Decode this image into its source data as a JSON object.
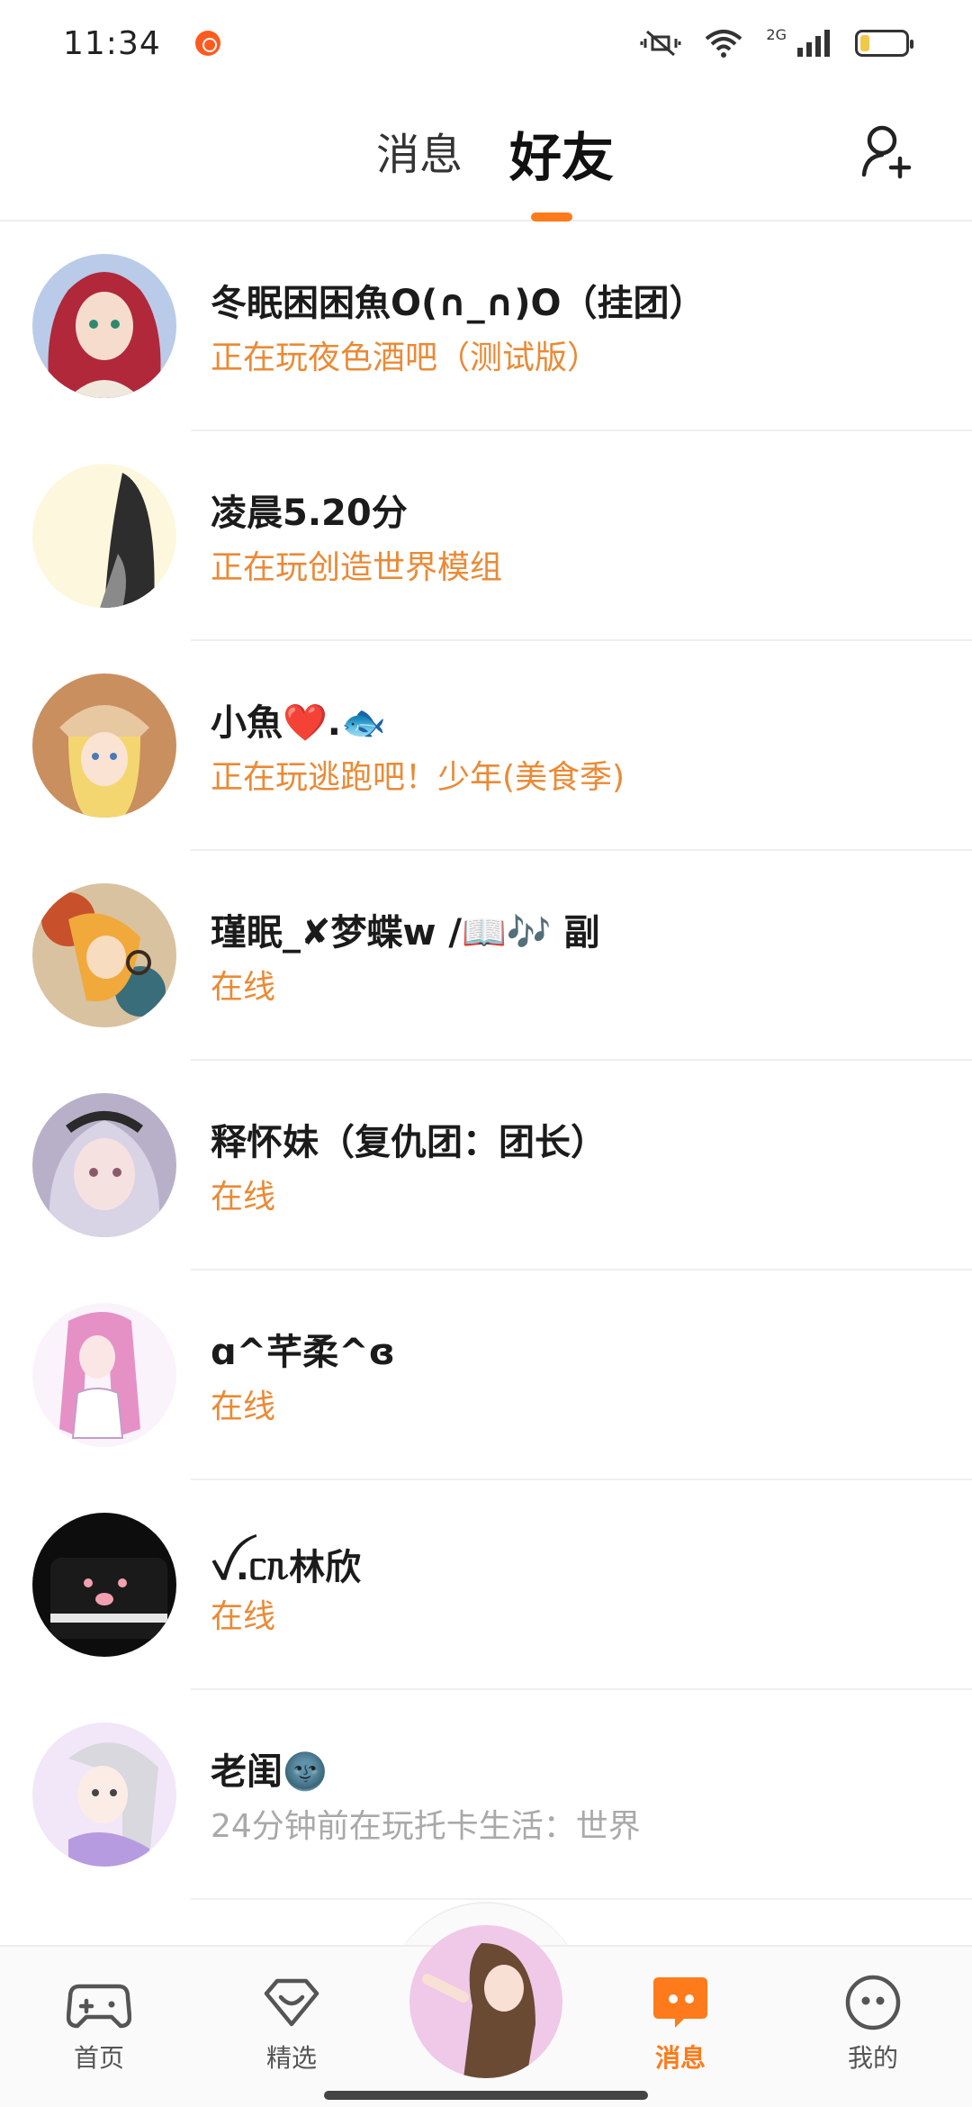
{
  "status_bar": {
    "time": "11:34",
    "network_label": "2G"
  },
  "header": {
    "tabs": [
      {
        "label": "消息",
        "active": false
      },
      {
        "label": "好友",
        "active": true
      }
    ]
  },
  "friends": [
    {
      "name": "冬眠困困魚O(∩_∩)O（挂团）",
      "status": "正在玩夜色酒吧（测试版）",
      "status_type": "playing"
    },
    {
      "name": "凌晨5.20分",
      "status": "正在玩创造世界模组",
      "status_type": "playing"
    },
    {
      "name": "小魚❤️.🐟",
      "status": "正在玩逃跑吧！少年(美食季)",
      "status_type": "playing"
    },
    {
      "name": "瑾眠_✘梦蝶w /📖🎶 副",
      "status": "在线",
      "status_type": "online"
    },
    {
      "name": "释怀妹（复仇团：团长）",
      "status": "在线",
      "status_type": "online"
    },
    {
      "name": "ɑ^芊柔^ɞ",
      "status": "在线",
      "status_type": "online"
    },
    {
      "name": "ꪜ.ᥴᥰ林欣",
      "status": "在线",
      "status_type": "online"
    },
    {
      "name": "老闺🌚",
      "status": "24分钟前在玩托卡生活：世界",
      "status_type": "offline"
    }
  ],
  "bottom_nav": {
    "items": [
      {
        "label": "首页",
        "icon": "gamepad-icon",
        "active": false
      },
      {
        "label": "精选",
        "icon": "diamond-heart-icon",
        "active": false
      },
      {
        "label": "消息",
        "icon": "chat-bubble-icon",
        "active": true
      },
      {
        "label": "我的",
        "icon": "smiley-face-icon",
        "active": false
      }
    ]
  },
  "colors": {
    "accent": "#ff7a1a",
    "status_orange": "#ea8a35",
    "status_gray": "#a9a9a9"
  }
}
